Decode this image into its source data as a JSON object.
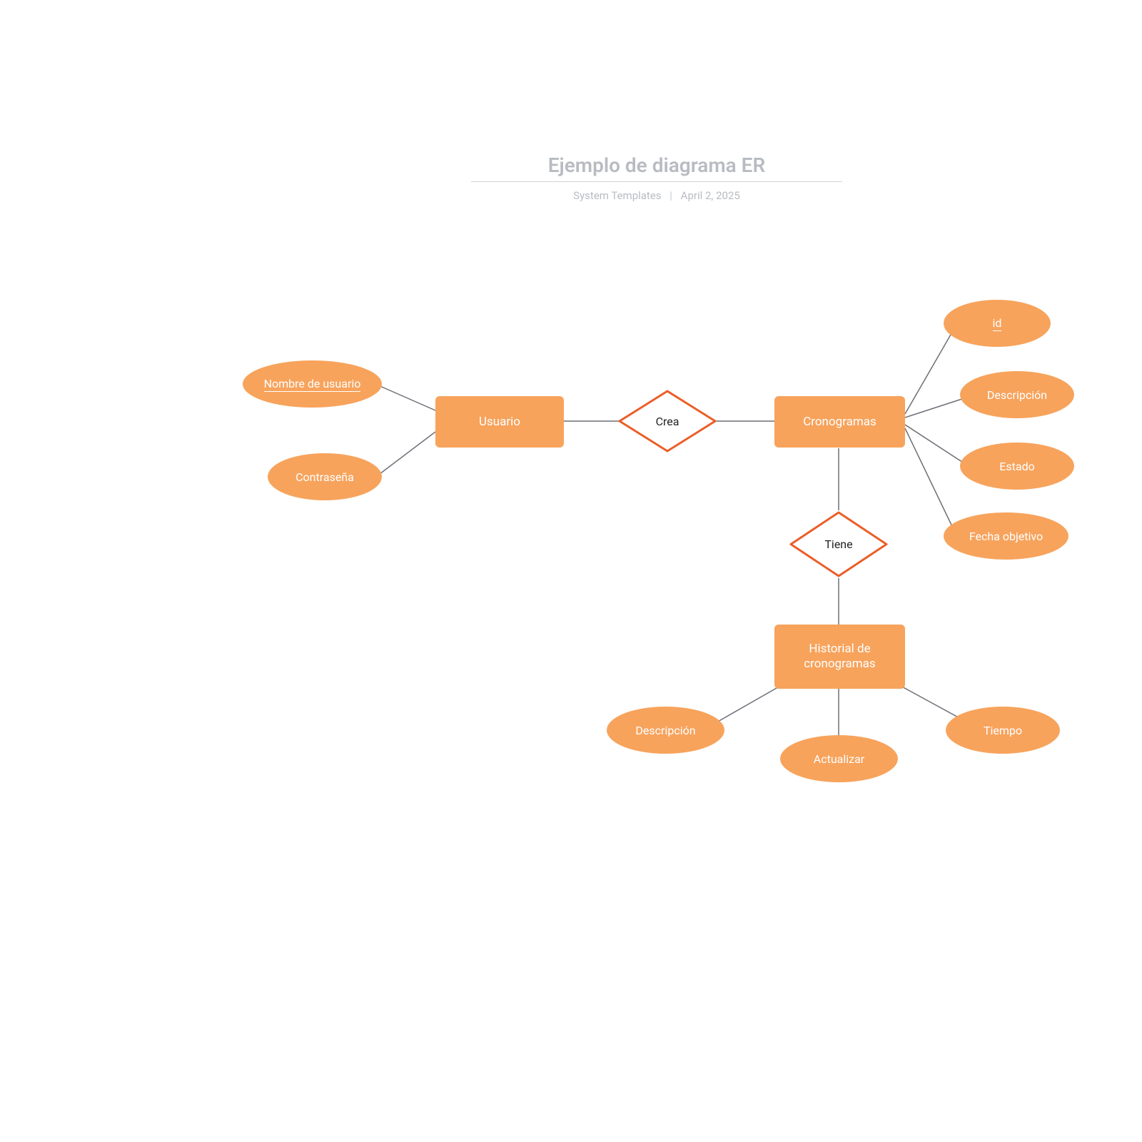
{
  "header": {
    "title": "Ejemplo de diagrama ER",
    "author": "System Templates",
    "date": "April 2, 2025"
  },
  "colors": {
    "fill": "#f7a35c",
    "stroke": "#eb5e28",
    "line": "#6b6f76"
  },
  "entities": {
    "usuario": {
      "label": "Usuario"
    },
    "cronogramas": {
      "label": "Cronogramas"
    },
    "historial": {
      "label": "Historial de cronogramas"
    }
  },
  "relationships": {
    "crea": {
      "label": "Crea"
    },
    "tiene": {
      "label": "Tiene"
    }
  },
  "attributes": {
    "usuario_nombre": {
      "label": "Nombre de usuario",
      "key": true
    },
    "usuario_contrasena": {
      "label": "Contraseña",
      "key": false
    },
    "crono_id": {
      "label": "id",
      "key": true
    },
    "crono_descripcion": {
      "label": "Descripción",
      "key": false
    },
    "crono_estado": {
      "label": "Estado",
      "key": false
    },
    "crono_fecha": {
      "label": "Fecha objetivo",
      "key": false
    },
    "hist_descripcion": {
      "label": "Descripción",
      "key": false
    },
    "hist_actualizar": {
      "label": "Actualizar",
      "key": false
    },
    "hist_tiempo": {
      "label": "Tiempo",
      "key": false
    }
  }
}
